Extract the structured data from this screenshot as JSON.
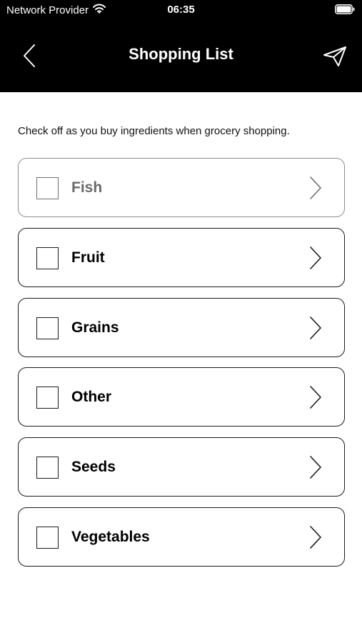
{
  "status_bar": {
    "carrier": "Network Provider",
    "time": "06:35",
    "wifi_icon": "wifi-icon",
    "battery_icon": "battery-icon"
  },
  "nav": {
    "title": "Shopping List",
    "back_icon": "chevron-left-icon",
    "send_icon": "paper-plane-icon"
  },
  "instructions": "Check off as you buy ingredients when grocery shopping.",
  "categories": [
    {
      "label": "Fish",
      "dimmed": true
    },
    {
      "label": "Fruit",
      "dimmed": false
    },
    {
      "label": "Grains",
      "dimmed": false
    },
    {
      "label": "Other",
      "dimmed": false
    },
    {
      "label": "Seeds",
      "dimmed": false
    },
    {
      "label": "Vegetables",
      "dimmed": false
    }
  ],
  "colors": {
    "header_bg": "#000000",
    "header_text": "#ffffff",
    "border": "#1a1a1a",
    "dimmed": "#6a6a6a"
  }
}
